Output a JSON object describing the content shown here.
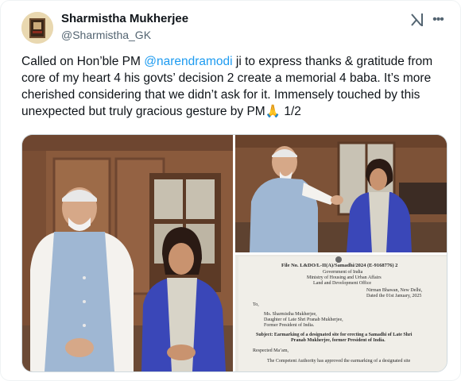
{
  "author": {
    "name": "Sharmistha Mukherjee",
    "handle": "@Sharmistha_GK"
  },
  "icons": {
    "grok": "grok-icon",
    "more": "more-icon"
  },
  "tweet": {
    "text_before": "Called on Hon’ble PM ",
    "mention": "@narendramodi",
    "text_after": " ji to express thanks & gratitude from core of my heart 4 his govts’ decision 2 create a memorial 4 baba. It’s more cherished considering that we didn’t ask for it. Immensely touched by this unexpected but truly gracious gesture by PM",
    "emoji": "🙏",
    "suffix": " 1/2"
  },
  "letter": {
    "file_no": "File No. L&DO/L-II(A)/Samadhi/2024 (E-9168776) 2",
    "gov": "Government of India",
    "ministry": "Ministry of Housing and Urban Affairs",
    "office": "Land and Development Office",
    "place": "Nirman Bhawan, New Delhi,",
    "date": "Dated the 01st January, 2025",
    "to": "To,",
    "addr1": "Ms. Sharmistha Mukherjee,",
    "addr2": "Daughter of Late Shri Pranab Mukherjee,",
    "addr3": "Former President of India.",
    "subject1": "Subject: Earmarking of a designated site for erecting a Samadhi of Late Shri",
    "subject2": "Pranab Mukherjee, former President of India.",
    "salutation": "Respected Ma’am,",
    "body": "The Competent Authority has approved the earmarking of a designated site"
  },
  "colors": {
    "accent": "#1d9bf0",
    "text": "#0f1419",
    "secondary": "#536471"
  }
}
